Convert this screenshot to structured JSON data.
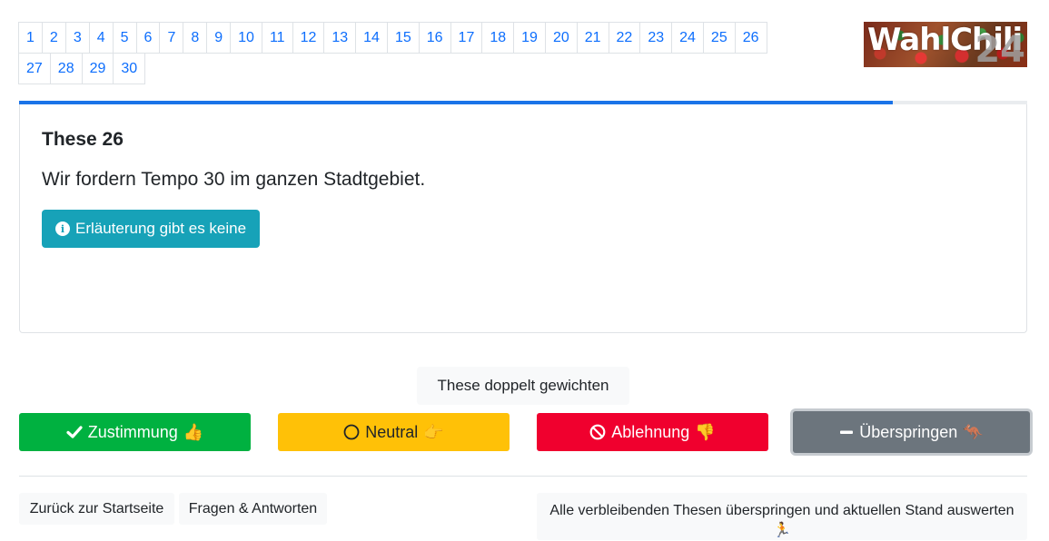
{
  "pagination": {
    "row1": [
      "1",
      "2",
      "3",
      "4",
      "5",
      "6",
      "7",
      "8",
      "9",
      "10",
      "11",
      "12",
      "13",
      "14",
      "15",
      "16",
      "17",
      "18",
      "19",
      "20",
      "21",
      "22",
      "23",
      "24",
      "25",
      "26"
    ],
    "row2": [
      "27",
      "28",
      "29",
      "30"
    ],
    "link_color": "#0d6efd"
  },
  "logo": {
    "text": "WahlChili",
    "number": "24"
  },
  "progress": {
    "value_percent": 86.7,
    "color": "#1a73e8"
  },
  "thesis": {
    "title": "These 26",
    "text": "Wir fordern Tempo 30 im ganzen Stadtgebiet.",
    "info_button": "Erläuterung gibt es keine",
    "info_icon": "info-circle-icon"
  },
  "double_weight_button": "These doppelt gewichten",
  "votes": {
    "agree": {
      "label": "Zustimmung",
      "emoji": "👍",
      "icon": "check-icon",
      "color": "#00b140"
    },
    "neutral": {
      "label": "Neutral",
      "emoji": "👉",
      "icon": "circle-icon",
      "color": "#ffc107"
    },
    "disagree": {
      "label": "Ablehnung",
      "emoji": "👎",
      "icon": "ban-icon",
      "color": "#f0002e"
    },
    "skip": {
      "label": "Überspringen",
      "emoji": "🦘",
      "icon": "minus-icon",
      "color": "#6c757d"
    }
  },
  "footer": {
    "home": "Zurück zur Startseite",
    "faq": "Fragen & Antworten",
    "skip_all": "Alle verbleibenden Thesen überspringen und aktuellen Stand auswerten",
    "skip_all_emoji": "🏃"
  }
}
